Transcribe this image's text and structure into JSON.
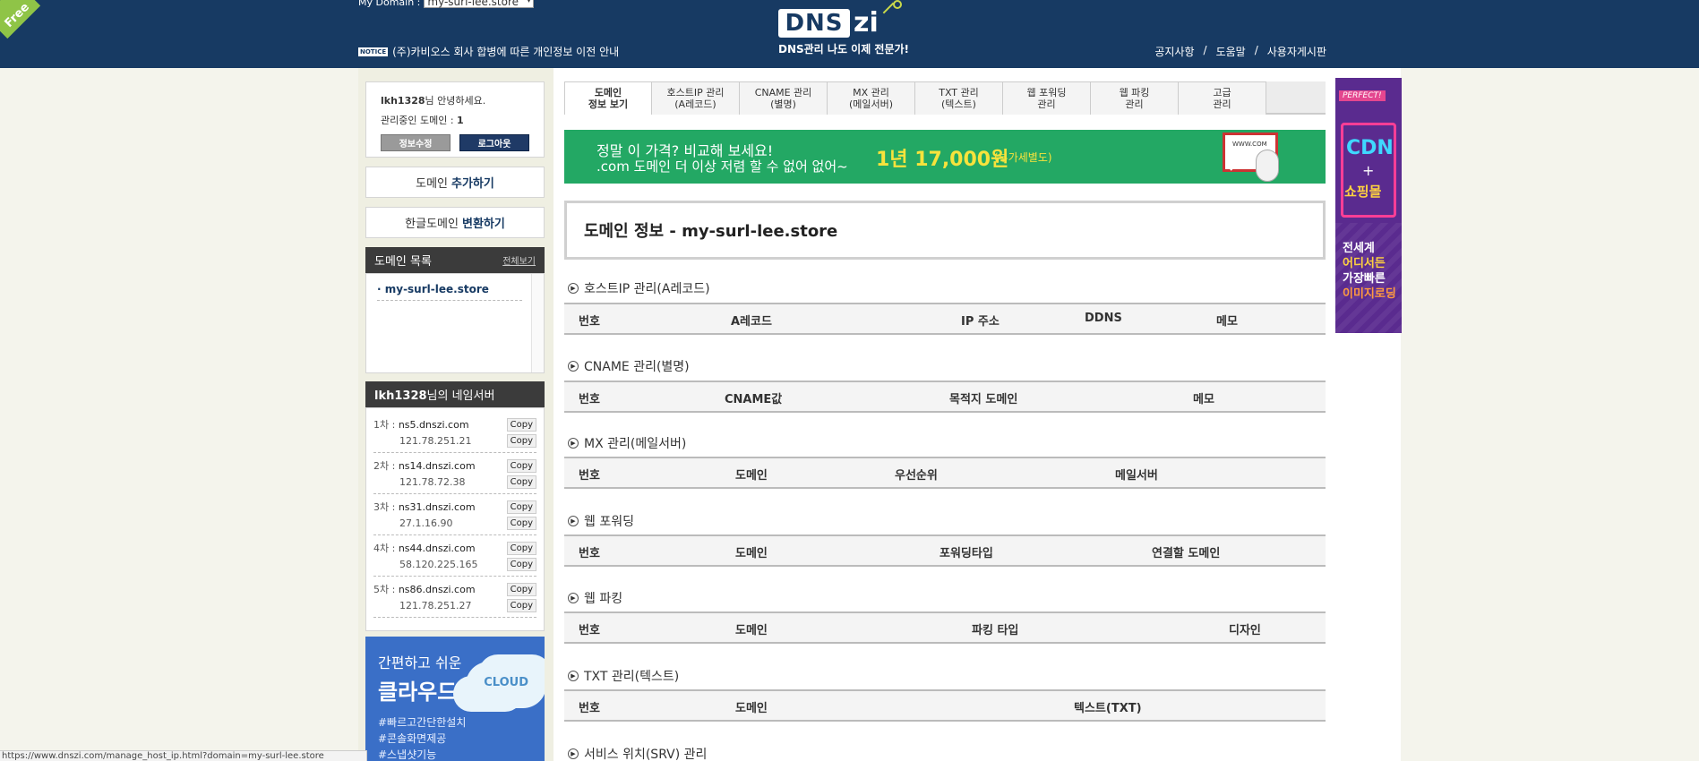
{
  "header": {
    "ribbon": "Free",
    "domain_label": "My Domain :",
    "domain_selected": "my-surl-lee.store",
    "notice_badge": "NOTICE",
    "notice_text": "(주)카비오스 회사 합병에 따른 개인정보 이전 안내",
    "logo_main": "DNS",
    "logo_zi": "zi",
    "tagline": "DNS관리 나도 이제 전문가!",
    "nav": [
      "공지사항",
      "도움말",
      "사용자게시판"
    ]
  },
  "sidebar": {
    "user_id": "lkh1328",
    "greet_suffix": "님 안녕하세요.",
    "managed_label": "관리중인 도메인 : ",
    "managed_count": "1",
    "edit_btn": "정보수정",
    "logout_btn": "로그아웃",
    "add_domain_pre": "도메인",
    "add_domain_bold": "추가하기",
    "convert_pre": "한글도메인",
    "convert_bold": "변환하기",
    "domain_list_title": "도메인 목록",
    "domain_list_more": "전체보기",
    "domains": [
      "· my-surl-lee.store"
    ],
    "ns_title_user": "lkh1328",
    "ns_title_suffix": "님의 네임서버",
    "nameservers": [
      {
        "label": "1차 : ",
        "host": "ns5.dnszi.com",
        "ip": "121.78.251.21"
      },
      {
        "label": "2차 : ",
        "host": "ns14.dnszi.com",
        "ip": "121.78.72.38"
      },
      {
        "label": "3차 : ",
        "host": "ns31.dnszi.com",
        "ip": "27.1.16.90"
      },
      {
        "label": "4차 : ",
        "host": "ns44.dnszi.com",
        "ip": "58.120.225.165"
      },
      {
        "label": "5차 : ",
        "host": "ns86.dnszi.com",
        "ip": "121.78.251.27"
      }
    ],
    "copy_label": "Copy",
    "cloud_ad": {
      "line1": "간편하고 쉬운",
      "line2": "클라우드",
      "badge": "CLOUD",
      "tags": [
        "#빠르고간단한설치",
        "#콘솔화면제공",
        "#스냅샷기능"
      ]
    }
  },
  "status_url": "https://www.dnszi.com/manage_host_ip.html?domain=my-surl-lee.store",
  "tabs": [
    [
      "도메인",
      "정보 보기"
    ],
    [
      "호스트IP 관리",
      "(A레코드)"
    ],
    [
      "CNAME 관리",
      "(별명)"
    ],
    [
      "MX 관리",
      "(메일서버)"
    ],
    [
      "TXT 관리",
      "(텍스트)"
    ],
    [
      "웹 포워딩",
      "관리"
    ],
    [
      "웹 파킹",
      "관리"
    ],
    [
      "고급",
      "관리"
    ]
  ],
  "promo": {
    "line1": "정말 이 가격? 비교해 보세요!",
    "line2": ".com 도메인 더 이상 저렴 할 수 없어 없어~",
    "price": "1년 17,000원",
    "vat": "(부가세별도)",
    "screen_text": "WWW.COM"
  },
  "page_title": "도메인 정보 - my-surl-lee.store",
  "sections": [
    {
      "title": "호스트IP 관리(A레코드)",
      "cols": [
        "번호",
        "A레코드",
        "IP 주소",
        "DDNS",
        "메모"
      ]
    },
    {
      "title": "CNAME 관리(별명)",
      "cols": [
        "번호",
        "CNAME값",
        "목적지 도메인",
        "메모"
      ]
    },
    {
      "title": "MX 관리(메일서버)",
      "cols": [
        "번호",
        "도메인",
        "우선순위",
        "메일서버"
      ]
    },
    {
      "title": "웹 포워딩",
      "cols": [
        "번호",
        "도메인",
        "포워딩타입",
        "연결할 도메인"
      ]
    },
    {
      "title": "웹 파킹",
      "cols": [
        "번호",
        "도메인",
        "파킹 타입",
        "디자인"
      ]
    },
    {
      "title": "TXT 관리(텍스트)",
      "cols": [
        "번호",
        "도메인",
        "텍스트(TXT)"
      ]
    },
    {
      "title": "서비스 위치(SRV) 관리",
      "cols": []
    }
  ],
  "side_ad": {
    "badge": "PERFECT!",
    "cdn": "CDN",
    "plus": "+",
    "shop": "쇼핑몰",
    "lines": [
      "전세계",
      "어디서든",
      "가장빠른",
      "이미지로딩"
    ]
  },
  "colors": {
    "header_bg": "#173a63",
    "promo_bg": "#23a864",
    "accent_yellow": "#f7e33c"
  }
}
